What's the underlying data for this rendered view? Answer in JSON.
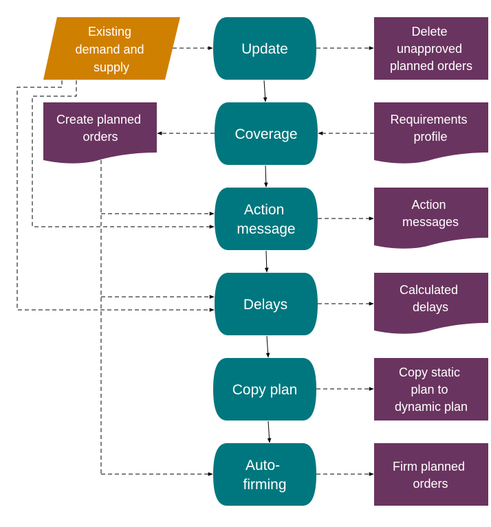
{
  "colors": {
    "process": "#00777E",
    "output": "#6A3460",
    "input": "#D08000",
    "text": "#FFFFFF",
    "connector": "#000000"
  },
  "input_node": {
    "id": "existing-demand-supply",
    "lines": [
      "Existing",
      "demand  and",
      "supply"
    ]
  },
  "processes": [
    {
      "id": "update",
      "lines": [
        "Update"
      ]
    },
    {
      "id": "coverage",
      "lines": [
        "Coverage"
      ]
    },
    {
      "id": "action-message",
      "lines": [
        "Action",
        "message"
      ]
    },
    {
      "id": "delays",
      "lines": [
        "Delays"
      ]
    },
    {
      "id": "copy-plan",
      "lines": [
        "Copy plan"
      ]
    },
    {
      "id": "auto-firming",
      "lines": [
        "Auto-",
        "firming"
      ]
    }
  ],
  "outputs": [
    {
      "id": "delete-unapproved",
      "shape": "rect",
      "lines": [
        "Delete",
        "unapproved",
        "planned  orders"
      ]
    },
    {
      "id": "requirements-profile",
      "shape": "document",
      "lines": [
        "Requirements",
        "profile"
      ]
    },
    {
      "id": "action-messages",
      "shape": "document",
      "lines": [
        "Action",
        "messages"
      ]
    },
    {
      "id": "calculated-delays",
      "shape": "document",
      "lines": [
        "Calculated",
        "delays"
      ]
    },
    {
      "id": "copy-static-plan",
      "shape": "rect",
      "lines": [
        "Copy static",
        "plan to",
        "dynamic plan"
      ]
    },
    {
      "id": "firm-planned-orders",
      "shape": "rect",
      "lines": [
        "Firm planned",
        "orders"
      ]
    }
  ],
  "side_document": {
    "id": "create-planned-orders",
    "lines": [
      "Create planned",
      "orders"
    ]
  },
  "edges": [
    {
      "from": "existing-demand-supply",
      "to": "update",
      "style": "dashed"
    },
    {
      "from": "update",
      "to": "delete-unapproved",
      "style": "dashed"
    },
    {
      "from": "update",
      "to": "coverage",
      "style": "solid"
    },
    {
      "from": "requirements-profile",
      "to": "coverage",
      "style": "dashed"
    },
    {
      "from": "coverage",
      "to": "create-planned-orders",
      "style": "dashed"
    },
    {
      "from": "coverage",
      "to": "action-message",
      "style": "solid"
    },
    {
      "from": "create-planned-orders",
      "to": "action-message",
      "style": "dashed"
    },
    {
      "from": "existing-demand-supply",
      "to": "action-message",
      "style": "dashed"
    },
    {
      "from": "action-message",
      "to": "action-messages",
      "style": "dashed"
    },
    {
      "from": "action-message",
      "to": "delays",
      "style": "solid"
    },
    {
      "from": "create-planned-orders",
      "to": "delays",
      "style": "dashed"
    },
    {
      "from": "existing-demand-supply",
      "to": "delays",
      "style": "dashed"
    },
    {
      "from": "delays",
      "to": "calculated-delays",
      "style": "dashed"
    },
    {
      "from": "delays",
      "to": "copy-plan",
      "style": "solid"
    },
    {
      "from": "copy-plan",
      "to": "copy-static-plan",
      "style": "dashed"
    },
    {
      "from": "copy-plan",
      "to": "auto-firming",
      "style": "solid"
    },
    {
      "from": "create-planned-orders",
      "to": "auto-firming",
      "style": "dashed"
    },
    {
      "from": "auto-firming",
      "to": "firm-planned-orders",
      "style": "dashed"
    }
  ]
}
